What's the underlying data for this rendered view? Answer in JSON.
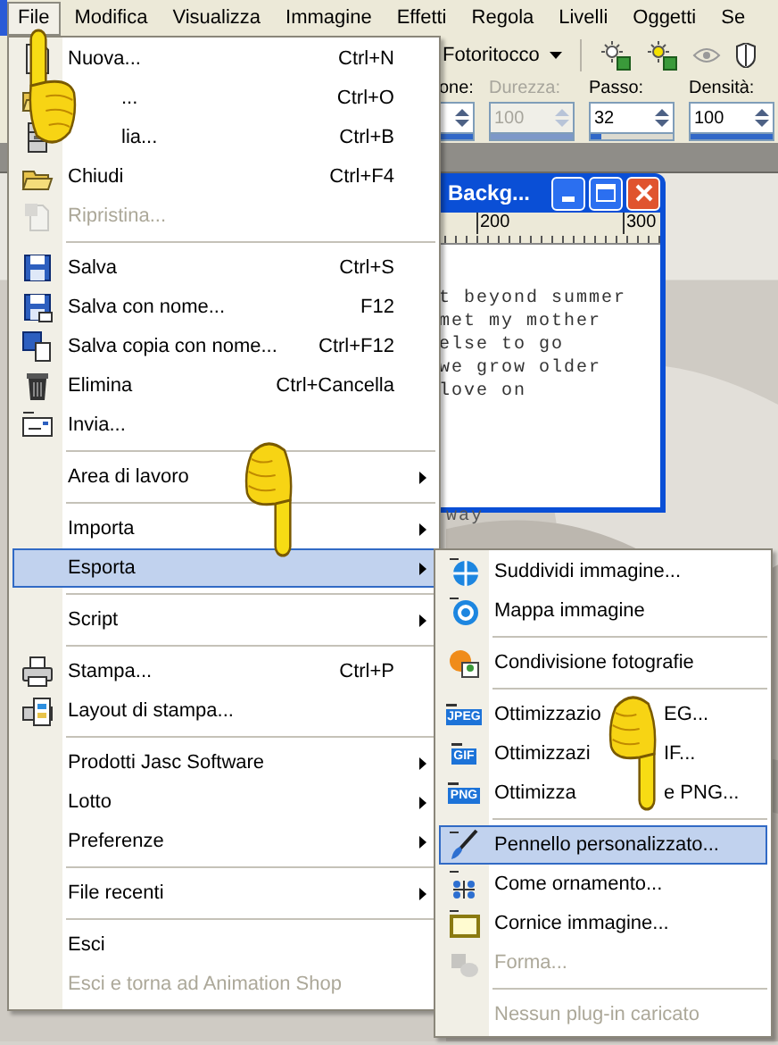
{
  "menu_bar": [
    {
      "label": "File",
      "selected": true
    },
    {
      "label": "Modifica",
      "selected": false
    },
    {
      "label": "Visualizza",
      "selected": false
    },
    {
      "label": "Immagine",
      "selected": false
    },
    {
      "label": "Effetti",
      "selected": false
    },
    {
      "label": "Regola",
      "selected": false
    },
    {
      "label": "Livelli",
      "selected": false
    },
    {
      "label": "Oggetti",
      "selected": false
    },
    {
      "label": "Se",
      "selected": false
    }
  ],
  "toolbar": {
    "preset": "Fotoritocco",
    "options": [
      {
        "label": "one:",
        "disabled": false,
        "level": 1
      },
      {
        "label": "Durezza:",
        "value": "100",
        "disabled": true,
        "level": 1
      },
      {
        "label": "Passo:",
        "value": "32",
        "disabled": false,
        "level": 0.13
      },
      {
        "label": "Densità:",
        "value": "100",
        "disabled": false,
        "level": 1
      }
    ]
  },
  "document_window": {
    "title": "Backg...",
    "ruler": [
      "200",
      "300"
    ],
    "lines": [
      "t beyond summer",
      "met my mother",
      "else to go",
      "we grow older",
      "love on"
    ],
    "outside_text": "way"
  },
  "file_menu": [
    {
      "kind": "item",
      "label": "Nuova...",
      "shortcut": "Ctrl+N",
      "selected": false,
      "disabled": false,
      "submenu": false
    },
    {
      "kind": "item",
      "label": "...",
      "covered": true,
      "shortcut": "Ctrl+O",
      "selected": false,
      "disabled": false,
      "submenu": false
    },
    {
      "kind": "item",
      "label": "lia...",
      "covered": true,
      "shortcut": "Ctrl+B",
      "selected": false,
      "disabled": false,
      "submenu": false
    },
    {
      "kind": "item",
      "label": "Chiudi",
      "shortcut": "Ctrl+F4",
      "selected": false,
      "disabled": false,
      "submenu": false
    },
    {
      "kind": "item",
      "label": "Ripristina...",
      "selected": false,
      "disabled": true,
      "submenu": false
    },
    {
      "kind": "separator"
    },
    {
      "kind": "item",
      "label": "Salva",
      "shortcut": "Ctrl+S",
      "selected": false,
      "disabled": false,
      "submenu": false
    },
    {
      "kind": "item",
      "label": "Salva con nome...",
      "shortcut": "F12",
      "selected": false,
      "disabled": false,
      "submenu": false
    },
    {
      "kind": "item",
      "label": "Salva copia con nome...",
      "shortcut": "Ctrl+F12",
      "selected": false,
      "disabled": false,
      "submenu": false
    },
    {
      "kind": "item",
      "label": "Elimina",
      "shortcut": "Ctrl+Cancella",
      "selected": false,
      "disabled": false,
      "submenu": false
    },
    {
      "kind": "item",
      "label": "Invia...",
      "selected": false,
      "disabled": false,
      "submenu": false
    },
    {
      "kind": "separator"
    },
    {
      "kind": "item",
      "label": "Area di lavoro",
      "selected": false,
      "disabled": false,
      "submenu": true
    },
    {
      "kind": "separator"
    },
    {
      "kind": "item",
      "label": "Importa",
      "selected": false,
      "disabled": false,
      "submenu": true
    },
    {
      "kind": "item",
      "label": "Esporta",
      "selected": true,
      "disabled": false,
      "submenu": true
    },
    {
      "kind": "separator"
    },
    {
      "kind": "item",
      "label": "Script",
      "selected": false,
      "disabled": false,
      "submenu": true
    },
    {
      "kind": "separator"
    },
    {
      "kind": "item",
      "label": "Stampa...",
      "shortcut": "Ctrl+P",
      "selected": false,
      "disabled": false,
      "submenu": false
    },
    {
      "kind": "item",
      "label": "Layout di stampa...",
      "selected": false,
      "disabled": false,
      "submenu": false
    },
    {
      "kind": "separator"
    },
    {
      "kind": "item",
      "label": "Prodotti Jasc Software",
      "selected": false,
      "disabled": false,
      "submenu": true
    },
    {
      "kind": "item",
      "label": "Lotto",
      "selected": false,
      "disabled": false,
      "submenu": true
    },
    {
      "kind": "item",
      "label": "Preferenze",
      "selected": false,
      "disabled": false,
      "submenu": true
    },
    {
      "kind": "separator"
    },
    {
      "kind": "item",
      "label": "File recenti",
      "selected": false,
      "disabled": false,
      "submenu": true
    },
    {
      "kind": "separator"
    },
    {
      "kind": "item",
      "label": "Esci",
      "selected": false,
      "disabled": false,
      "submenu": false
    },
    {
      "kind": "item",
      "label": "Esci e torna ad Animation Shop",
      "selected": false,
      "disabled": true,
      "submenu": false
    }
  ],
  "export_submenu": [
    {
      "kind": "item",
      "label": "Suddividi immagine...",
      "selected": false,
      "disabled": false
    },
    {
      "kind": "item",
      "label": "Mappa immagine",
      "selected": false,
      "disabled": false
    },
    {
      "kind": "separator"
    },
    {
      "kind": "item",
      "label": "Condivisione fotografie",
      "selected": false,
      "disabled": false
    },
    {
      "kind": "separator"
    },
    {
      "kind": "item",
      "label": "Ottimizzazio",
      "tail": "EG...",
      "badge": "JPEG",
      "selected": false,
      "disabled": false
    },
    {
      "kind": "item",
      "label": "Ottimizzazi",
      "tail": "IF...",
      "badge": "GIF",
      "selected": false,
      "disabled": false
    },
    {
      "kind": "item",
      "label": "Ottimizza",
      "tail": "e PNG...",
      "badge": "PNG",
      "selected": false,
      "disabled": false
    },
    {
      "kind": "separator"
    },
    {
      "kind": "item",
      "label": "Pennello personalizzato...",
      "selected": true,
      "disabled": false
    },
    {
      "kind": "item",
      "label": "Come ornamento...",
      "selected": false,
      "disabled": false
    },
    {
      "kind": "item",
      "label": "Cornice immagine...",
      "selected": false,
      "disabled": false
    },
    {
      "kind": "item",
      "label": "Forma...",
      "selected": false,
      "disabled": true
    },
    {
      "kind": "separator"
    },
    {
      "kind": "item",
      "label": "Nessun plug-in caricato",
      "selected": false,
      "disabled": true
    }
  ]
}
